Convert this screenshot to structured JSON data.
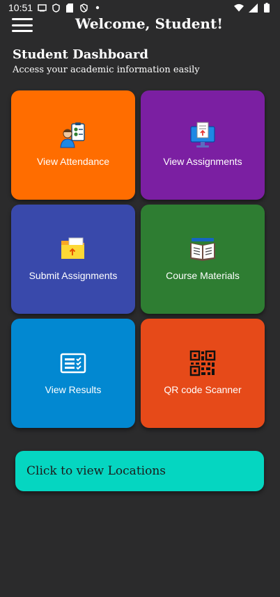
{
  "status_bar": {
    "time": "10:51"
  },
  "header": {
    "title": "Welcome, Student!"
  },
  "dashboard": {
    "title": "Student Dashboard",
    "subtitle": "Access your academic information easily"
  },
  "tiles": [
    {
      "label": "View Attendance",
      "color": "#ff6d00",
      "icon": "attendance-icon"
    },
    {
      "label": "View Assignments",
      "color": "#7b1fa2",
      "icon": "assignments-monitor-icon"
    },
    {
      "label": "Submit Assignments",
      "color": "#3949ab",
      "icon": "folder-upload-icon"
    },
    {
      "label": "Course Materials",
      "color": "#2e7d32",
      "icon": "open-book-icon"
    },
    {
      "label": "View Results",
      "color": "#0288d1",
      "icon": "checklist-icon"
    },
    {
      "label": "QR code Scanner",
      "color": "#e64a19",
      "icon": "qr-code-icon"
    }
  ],
  "locations_button": {
    "label": "Click to view Locations",
    "color": "#05d6c1"
  }
}
